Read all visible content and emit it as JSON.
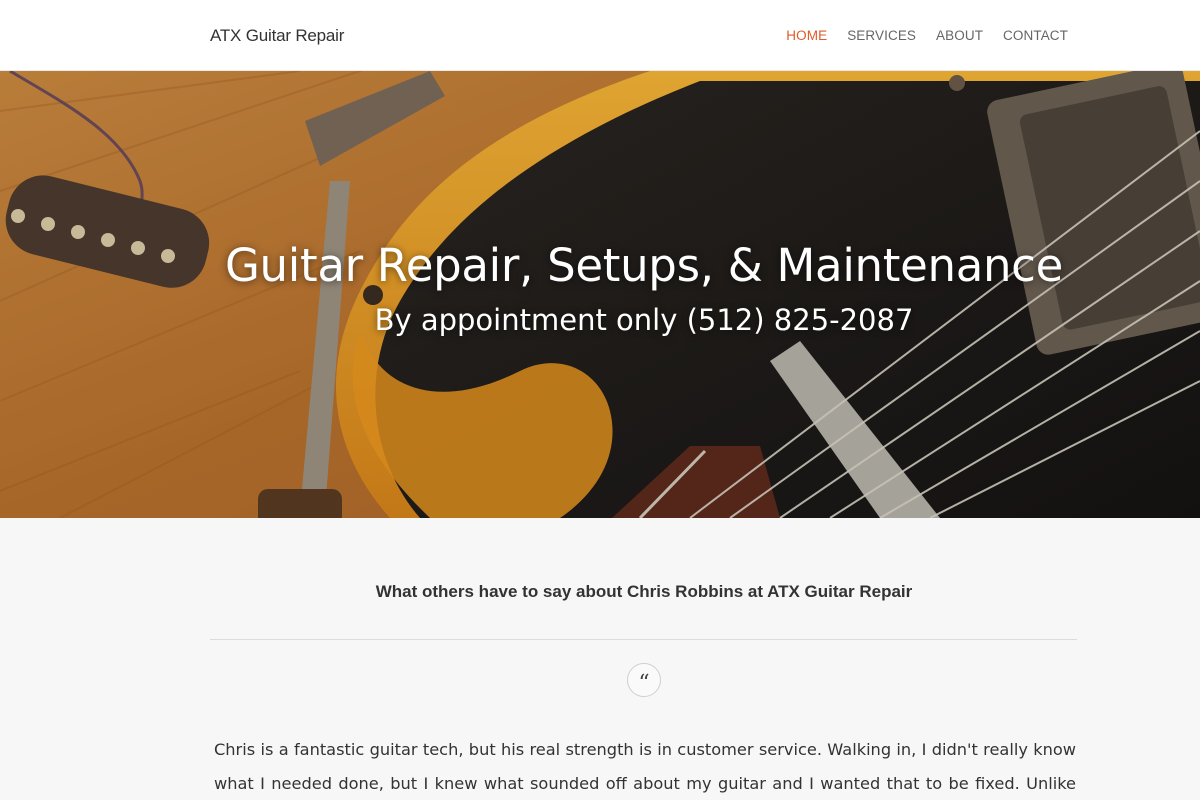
{
  "header": {
    "brand": "ATX Guitar Repair",
    "nav": [
      {
        "label": "HOME",
        "active": true
      },
      {
        "label": "SERVICES",
        "active": false
      },
      {
        "label": "ABOUT",
        "active": false
      },
      {
        "label": "CONTACT",
        "active": false
      }
    ],
    "accent_color": "#e05a2a"
  },
  "hero": {
    "title": "Guitar Repair, Setups, & Maintenance",
    "subtitle": "By appointment only (512) 825-2087"
  },
  "testimonials": {
    "heading": "What others have to say about Chris Robbins at ATX Guitar Repair",
    "quote_icon": "quote-icon",
    "quote": "Chris is a fantastic guitar tech, but his real strength is in customer service. Walking in, I didn't really know what I needed done, but I knew what sounded off about my guitar and I wanted that to be fixed. Unlike many other guitar shops, Chris"
  }
}
